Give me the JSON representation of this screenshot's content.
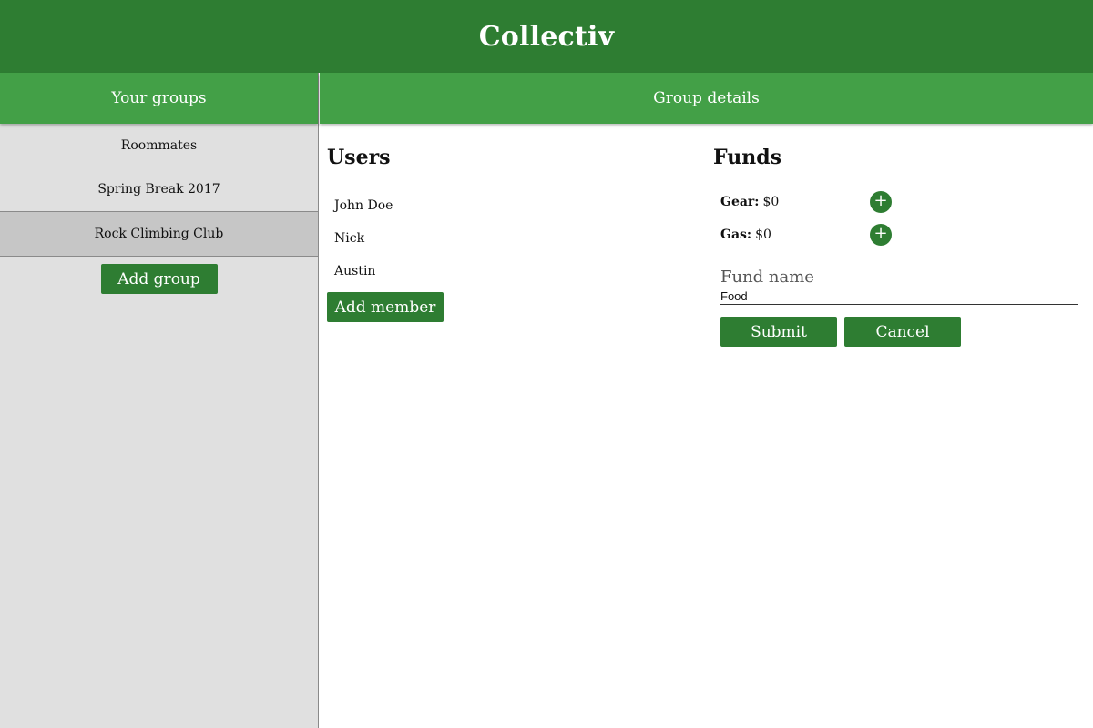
{
  "app": {
    "title": "Collectiv"
  },
  "sidebar": {
    "header": "Your groups",
    "groups": [
      {
        "label": "Roommates",
        "selected": false
      },
      {
        "label": "Spring Break 2017",
        "selected": false
      },
      {
        "label": "Rock Climbing Club",
        "selected": true
      }
    ],
    "add_group_label": "Add group"
  },
  "details": {
    "header": "Group details",
    "users": {
      "title": "Users",
      "items": [
        "John Doe",
        "Nick",
        "Austin"
      ],
      "add_member_label": "Add member"
    },
    "funds": {
      "title": "Funds",
      "items": [
        {
          "name": "Gear:",
          "amount": "$0",
          "add_icon": "+"
        },
        {
          "name": "Gas:",
          "amount": "$0",
          "add_icon": "+"
        }
      ],
      "new_fund": {
        "label": "Fund name",
        "value": "Food"
      },
      "submit_label": "Submit",
      "cancel_label": "Cancel"
    }
  },
  "colors": {
    "header_dark_green": "#2e7d32",
    "header_light_green": "#43a047",
    "sidebar_bg": "#e0e0e0",
    "selected_bg": "#c6c6c6"
  }
}
